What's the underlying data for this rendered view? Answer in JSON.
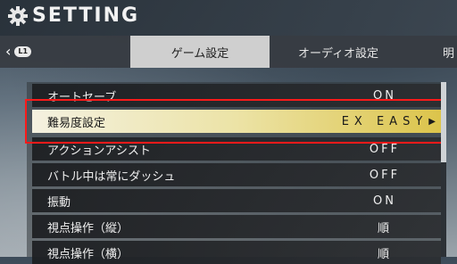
{
  "header": {
    "title": "SETTING",
    "icon": "gear-icon"
  },
  "nav": {
    "back_icon": "chevron-left-icon",
    "button_label": "L1"
  },
  "tabs": [
    {
      "label": "ゲーム設定",
      "active": true
    },
    {
      "label": "オーディオ設定",
      "active": false
    },
    {
      "label": "明",
      "active": false
    }
  ],
  "settings": [
    {
      "label": "オートセーブ",
      "value": "ON"
    },
    {
      "label": "難易度設定",
      "value": "EX EASY",
      "selected": true
    },
    {
      "label": "アクションアシスト",
      "value": "OFF"
    },
    {
      "label": "バトル中は常にダッシュ",
      "value": "OFF"
    },
    {
      "label": "振動",
      "value": "ON"
    },
    {
      "label": "視点操作（縦）",
      "value": "順"
    },
    {
      "label": "視点操作（横）",
      "value": "順"
    }
  ],
  "colors": {
    "highlight": "#ff1a1a",
    "selected_row": "#dcc44b"
  }
}
